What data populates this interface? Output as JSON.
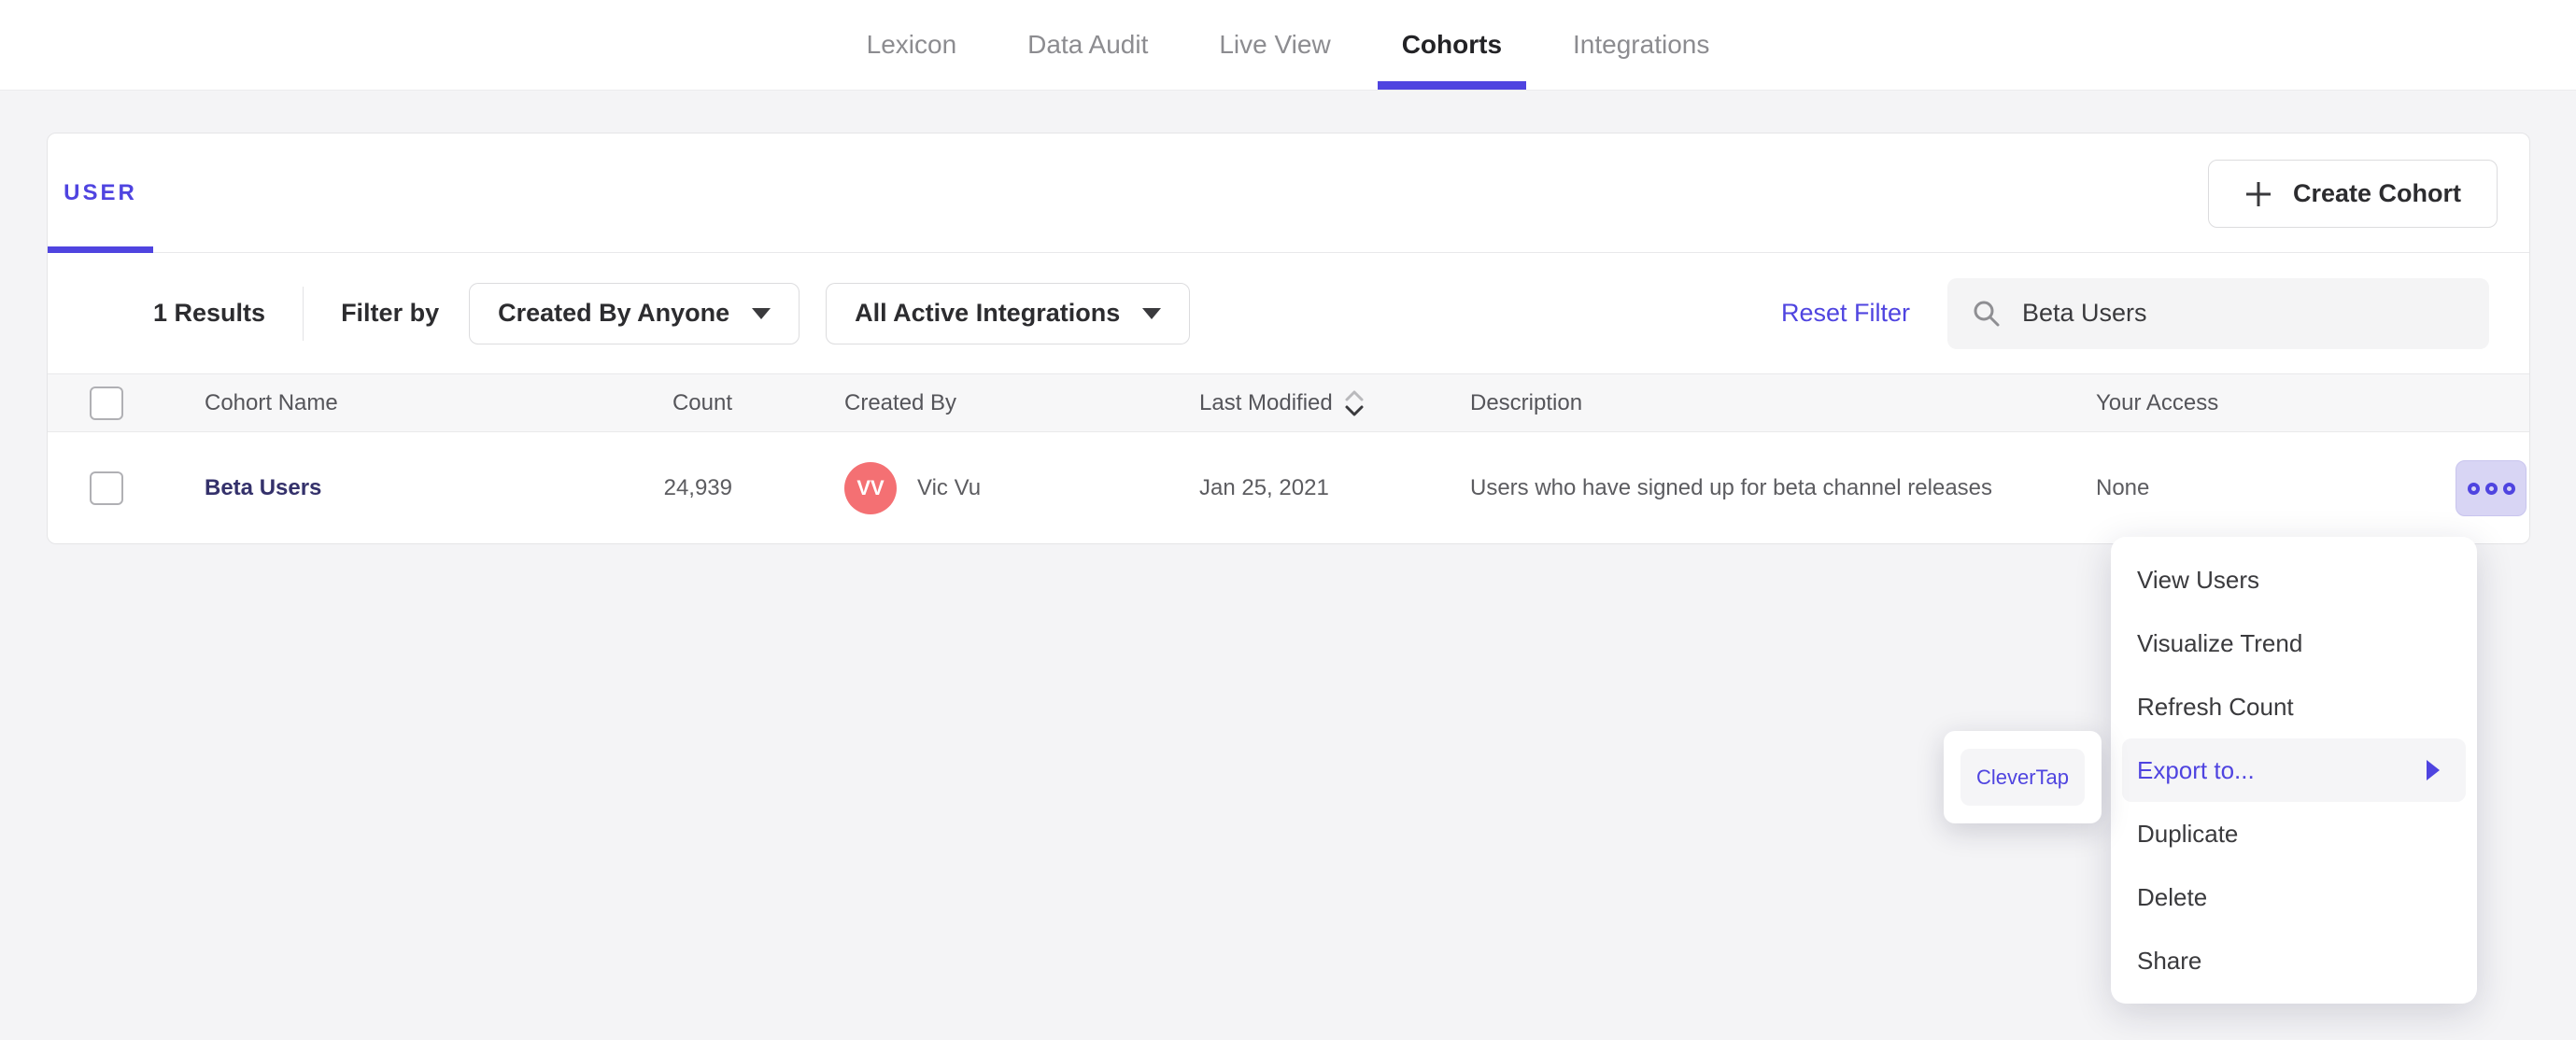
{
  "nav": {
    "tabs": [
      {
        "label": "Lexicon",
        "active": false
      },
      {
        "label": "Data Audit",
        "active": false
      },
      {
        "label": "Live View",
        "active": false
      },
      {
        "label": "Cohorts",
        "active": true
      },
      {
        "label": "Integrations",
        "active": false
      }
    ]
  },
  "cohorts_card": {
    "tab_label": "USER",
    "create_button_label": "Create Cohort",
    "filter_bar": {
      "results_count": "1 Results",
      "filter_by_label": "Filter by",
      "created_by_dropdown_value": "Created By Anyone",
      "integrations_dropdown_value": "All Active Integrations",
      "reset_filter_label": "Reset Filter",
      "search_value": "Beta Users"
    },
    "table": {
      "headers": {
        "name": "Cohort Name",
        "count": "Count",
        "created_by": "Created By",
        "last_modified": "Last Modified",
        "description": "Description",
        "your_access": "Your Access"
      },
      "rows": [
        {
          "name": "Beta Users",
          "count": "24,939",
          "avatar_initials": "VV",
          "created_by": "Vic Vu",
          "last_modified": "Jan 25, 2021",
          "description": "Users who have signed up for beta channel releases",
          "your_access": "None"
        }
      ]
    }
  },
  "context_menu": {
    "items": [
      "View Users",
      "Visualize Trend",
      "Refresh Count",
      "Export to...",
      "Duplicate",
      "Delete",
      "Share"
    ],
    "highlighted_item": "Export to...",
    "submenu_items": [
      "CleverTap"
    ]
  },
  "colors": {
    "accent": "#4f44e0",
    "avatar": "#f47073",
    "cohort_link": "#34316b",
    "more_button_bg": "#d8d5f4"
  }
}
